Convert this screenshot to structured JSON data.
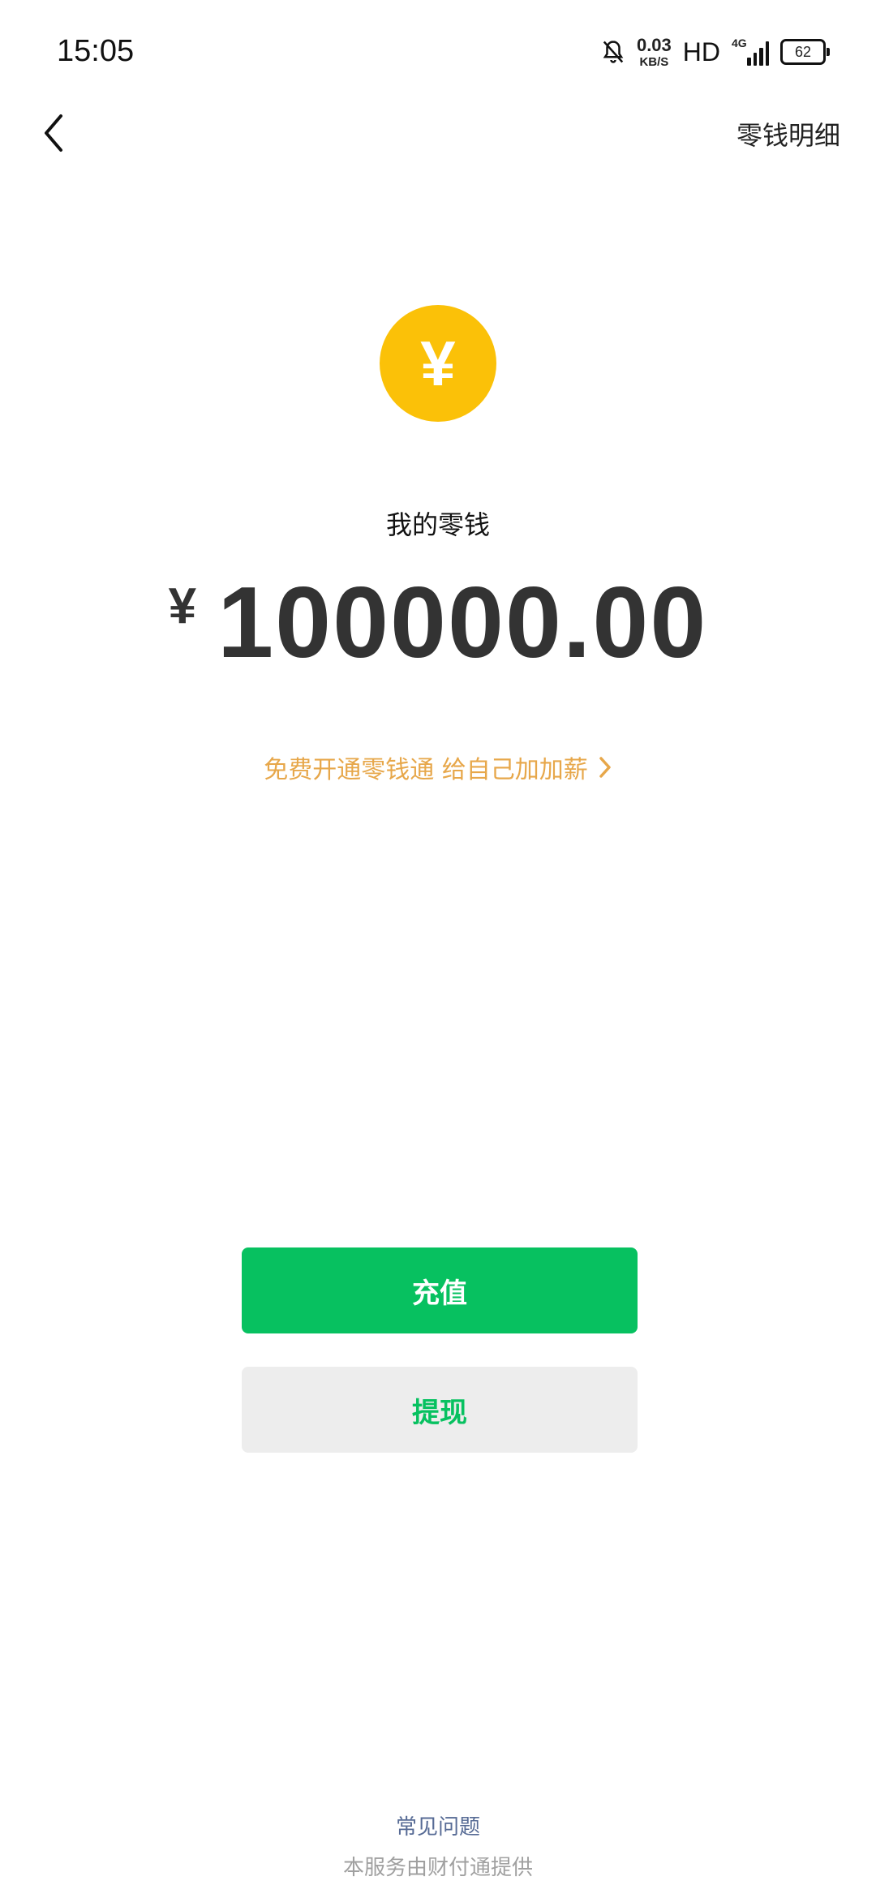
{
  "status_bar": {
    "time": "15:05",
    "net_speed_value": "0.03",
    "net_speed_unit": "KB/S",
    "hd": "HD",
    "network": "4G",
    "battery": "62"
  },
  "nav": {
    "back_icon": "chevron-left-icon",
    "detail_link": "零钱明细"
  },
  "balance": {
    "coin_symbol": "¥",
    "label": "我的零钱",
    "currency": "¥",
    "amount": "100000.00"
  },
  "promo": {
    "text": "免费开通零钱通 给自己加加薪",
    "arrow_icon": "chevron-right-icon",
    "color": "#e7a74a"
  },
  "actions": {
    "recharge": "充值",
    "withdraw": "提现",
    "primary_color": "#07c160"
  },
  "footer": {
    "faq": "常见问题",
    "provider": "本服务由财付通提供"
  }
}
